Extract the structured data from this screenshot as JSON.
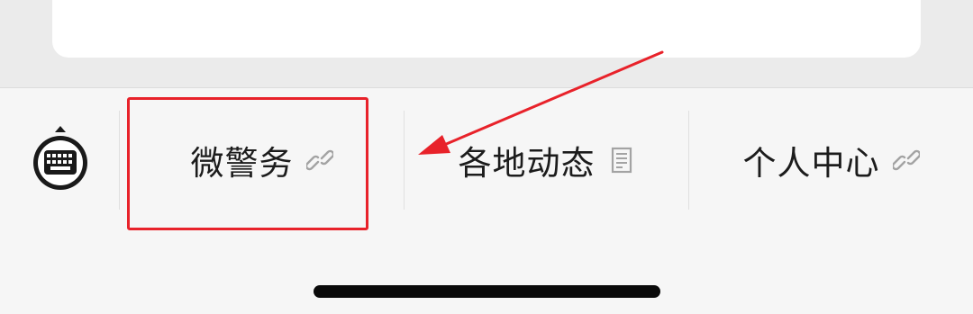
{
  "menu": {
    "items": [
      {
        "label": "微警务",
        "icon": "link-icon"
      },
      {
        "label": "各地动态",
        "icon": "document-icon"
      },
      {
        "label": "个人中心",
        "icon": "link-icon"
      }
    ]
  },
  "colors": {
    "annotation": "#e8222a",
    "menubar_background": "#f6f6f6",
    "text": "#1c1c1c"
  }
}
